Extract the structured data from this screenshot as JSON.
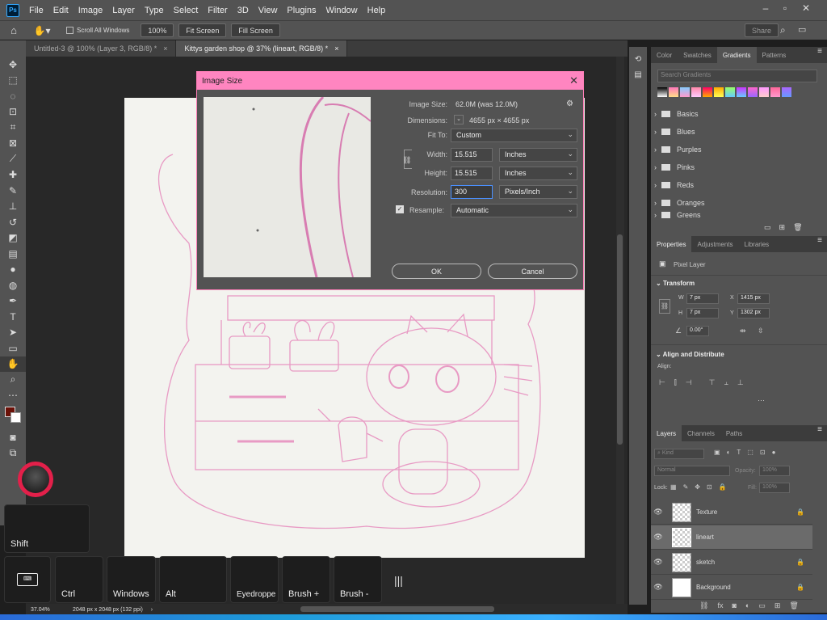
{
  "app": {
    "logo": "Ps"
  },
  "menu": [
    "File",
    "Edit",
    "Image",
    "Layer",
    "Type",
    "Select",
    "Filter",
    "3D",
    "View",
    "Plugins",
    "Window",
    "Help"
  ],
  "options": {
    "scroll_all": "Scroll All Windows",
    "zoom_btn": "100%",
    "fit_btn": "Fit Screen",
    "fill_btn": "Fill Screen",
    "share": "Share"
  },
  "tabs": [
    {
      "label": "Untitled-3 @ 100% (Layer 3, RGB/8) *"
    },
    {
      "label": "Kittys garden shop @ 37% (lineart, RGB/8) *"
    }
  ],
  "dialog": {
    "title": "Image Size",
    "image_size_label": "Image Size:",
    "image_size_value": "62.0M (was 12.0M)",
    "dimensions_label": "Dimensions:",
    "dimensions_value": "4655 px  ×  4655 px",
    "fit_to_label": "Fit To:",
    "fit_to_value": "Custom",
    "width_label": "Width:",
    "width_value": "15.515",
    "width_unit": "Inches",
    "height_label": "Height:",
    "height_value": "15.515",
    "height_unit": "Inches",
    "resolution_label": "Resolution:",
    "resolution_value": "300",
    "resolution_unit": "Pixels/Inch",
    "resample_label": "Resample:",
    "resample_value": "Automatic",
    "ok": "OK",
    "cancel": "Cancel"
  },
  "panels": {
    "gradient_tabs": [
      "Color",
      "Swatches",
      "Gradients",
      "Patterns"
    ],
    "search_placeholder": "Search Gradients",
    "gradient_folders": [
      "Basics",
      "Blues",
      "Purples",
      "Pinks",
      "Reds",
      "Oranges",
      "Greens"
    ],
    "props_tabs": [
      "Properties",
      "Adjustments",
      "Libraries"
    ],
    "pixel_layer": "Pixel Layer",
    "transform": "Transform",
    "w_label": "W",
    "w_value": "7 px",
    "h_label": "H",
    "h_value": "7 px",
    "x_label": "X",
    "x_value": "1415 px",
    "y_label": "Y",
    "y_value": "1302 px",
    "angle_value": "0.00°",
    "align_distribute": "Align and Distribute",
    "align_label": "Align:",
    "layers_tabs": [
      "Layers",
      "Channels",
      "Paths"
    ],
    "kind": "Kind",
    "blend": "Normal",
    "opacity_label": "Opacity:",
    "opacity_value": "100%",
    "lock_label": "Lock:",
    "fill_label": "Fill:",
    "fill_value": "100%",
    "layers": [
      "Texture",
      "lineart",
      "sketch",
      "Background"
    ]
  },
  "keys": {
    "shift": "Shift",
    "ctrl": "Ctrl",
    "windows": "Windows",
    "alt": "Alt",
    "eyedropper": "Eyedroppe",
    "brush_plus": "Brush +",
    "brush_minus": "Brush -"
  },
  "status": {
    "zoom": "37.04%",
    "doc": "2048 px x 2048 px (132 ppi)"
  },
  "colors": {
    "dialog_accent": "#ff85c0",
    "lineart": "#e89ac4",
    "foreground": "#6b1108"
  }
}
